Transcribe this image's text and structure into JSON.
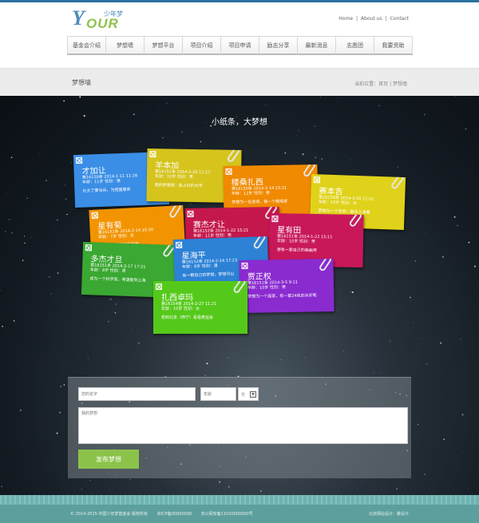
{
  "header": {
    "logo_letter": "Y",
    "logo_text": "OUR",
    "logo_cn": "少年梦",
    "links": [
      "Home",
      "|",
      "About us",
      "|",
      "Contact"
    ],
    "nav": [
      "基金会介绍",
      "梦想墙",
      "梦想平台",
      "项目介绍",
      "项目申请",
      "励志分享",
      "最新消息",
      "志愿团",
      "我要资助"
    ]
  },
  "page": {
    "title": "梦想墙",
    "breadcrumb": "当前位置：首页 | 梦想墙"
  },
  "slogan": "小纸条，大梦想",
  "notes": [
    {
      "name": "才加让",
      "meta1": "第16150条 2014-1-11 11:26",
      "meta2": "年龄：11岁  性别：男",
      "wish": "长大了要当兵，为祖国服务",
      "color": "#3a8ee6"
    },
    {
      "name": "羊本加",
      "meta1": "第16152条 2014-2-20 11:27",
      "meta2": "年龄：10岁  性别：男",
      "wish": "我的梦想是：能上好的大学",
      "color": "#d6c41d"
    },
    {
      "name": "楼桑扎西",
      "meta1": "第16150条 2014-2-14 15:21",
      "meta2": "年龄：12岁  性别：男",
      "wish": "梦想为一名老师，做一个歌唱家",
      "color": "#f08a00"
    },
    {
      "name": "赛本吉",
      "meta1": "第16150条 2014-2-20 11:21",
      "meta2": "年龄：10岁  性别：女",
      "wish": "梦想为一个老师，能去上海看",
      "color": "#e0d21a"
    },
    {
      "name": "赛杰才让",
      "meta1": "第16152条 2014-1-22 15:21",
      "meta2": "年龄：11岁  性别：男",
      "wish": "",
      "color": "#c4184c"
    },
    {
      "name": "星有菊",
      "meta1": "第16152条 2014-2-14 15:10",
      "meta2": "年龄：7岁  性别：女",
      "wish": "想有一套自己的画画用",
      "color": "#f29400"
    },
    {
      "name": "星有田",
      "meta1": "第16151条 2014-1-22 15:11",
      "meta2": "年龄：10岁  性别：男",
      "wish": "想有一套自己的画画用",
      "color": "#c8185a"
    },
    {
      "name": "多杰才旦",
      "meta1": "第16151条 2014-2-17 17:21",
      "meta2": "年龄：8岁  性别：男",
      "wish": "成为一个科学家，希望能到上海",
      "color": "#3aa832"
    },
    {
      "name": "星海平",
      "meta1": "第16152条 2014-2-14 17:23",
      "meta2": "年龄：8岁  性别：男",
      "wish": "有一颗自己的梦想，梦想可以",
      "color": "#2d82d6"
    },
    {
      "name": "贾正权",
      "meta1": "第16151条 2014-3-5 9:11",
      "meta2": "年龄：10岁  性别：男",
      "wish": "梦想为一个画家，有一套24色的水彩笔",
      "color": "#8a2bd0"
    },
    {
      "name": "扎西卓玛",
      "meta1": "第16154条 2014-2-27 11:21",
      "meta2": "年龄：10岁  性别：女",
      "wish": "想到北京（西宁）看看奥运会",
      "color": "#55c91a"
    }
  ],
  "form": {
    "name_placeholder": "您的名字",
    "age_placeholder": "年龄",
    "gender_value": "男",
    "dream_placeholder": "我的梦想",
    "submit": "发布梦想"
  },
  "footer": {
    "copyright": "© 2014-2015  中国少年梦基金会  版权所有",
    "icp": "京ICP备00000000",
    "police": "京公网安备11010000000号",
    "design": "北京网站设计：聚设计"
  }
}
